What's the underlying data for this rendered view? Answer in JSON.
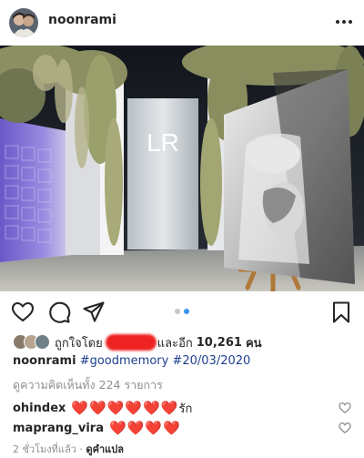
{
  "post": {
    "username": "noonrami",
    "likes_prefix": "ถูกใจโดย",
    "likes_suffix": "และอีก",
    "likes_count": "10,261",
    "likes_unit": "คน",
    "caption_user": "noonrami",
    "caption_text": "#goodmemory #20/03/2020",
    "view_comments": "ดูความคิดเห็นทั้ง 224 รายการ",
    "time_ago": "2 ชั่วโมงที่แล้ว",
    "separator": " · ",
    "translate_label": "ดูคำแปล",
    "carousel_total": 2,
    "carousel_active": 2,
    "photo_sign": "LR"
  },
  "comments": [
    {
      "user": "ohindex",
      "hearts": "❤️❤️❤️❤️❤️❤️",
      "text": "รัก"
    },
    {
      "user": "maprang_vira",
      "hearts": "❤️❤️❤️❤️",
      "text": ""
    }
  ],
  "colors": {
    "heart": "#ff3040",
    "carousel_active": "#3897f0",
    "carousel_inactive": "#c7c7c7",
    "hashtag": "#1d3f8f",
    "muted": "#8e8e8e"
  },
  "icons": [
    "more-icon",
    "heart-icon",
    "comment-icon",
    "share-icon",
    "bookmark-icon",
    "comment-like-icon"
  ]
}
